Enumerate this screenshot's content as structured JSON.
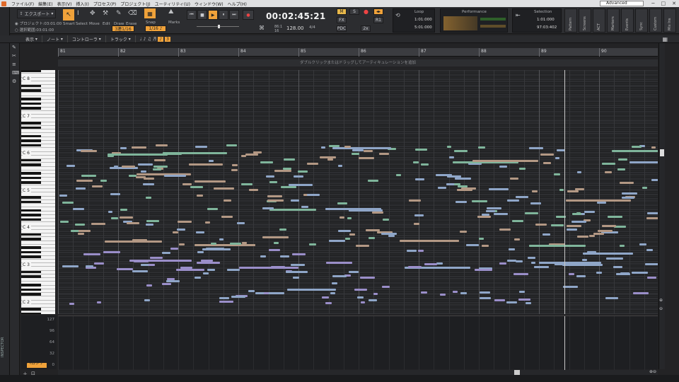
{
  "menu": [
    "ファイル(F)",
    "編集(E)",
    "表示(V)",
    "挿入(I)",
    "プロセス(P)",
    "プロジェクト(J)",
    "ユーティリティ(U)",
    "ウィンドウ(W)",
    "ヘルプ(H)"
  ],
  "workspace": "Advanced",
  "export": {
    "label": "エクスポート"
  },
  "project_info": {
    "project": "プロジェクト:03:01:00",
    "selection": "選択範囲:03:01:00"
  },
  "tools": [
    "Smart",
    "Select",
    "Move",
    "Edit",
    "Draw",
    "Erase"
  ],
  "snap": {
    "label": "Snap",
    "value": "3連1/16",
    "grid": "1/16",
    "marks": "Marks",
    "count": "3"
  },
  "transport": {
    "time": "00:02:45:21",
    "tempo": "128.00",
    "meter": "4/4",
    "measure": "86:1",
    "beat": "4/4",
    "sub": "16"
  },
  "mix": {
    "m": "M",
    "s": "S",
    "fx": "FX",
    "pdc": "PDC",
    "r1": "R1",
    "x2": "2x"
  },
  "loop": {
    "title": "Loop",
    "start": "1:01:000",
    "end": "5:01:000"
  },
  "performance": {
    "title": "Performance"
  },
  "selection": {
    "title": "Selection",
    "start": "1:01:000",
    "end": "97:03:402"
  },
  "side_tabs": [
    "Pattern",
    "Screens",
    "ACT",
    "Markers",
    "Events",
    "Sync",
    "Custom",
    "Mix Ins"
  ],
  "subtool": {
    "view": "表示",
    "note": "ノート",
    "controller": "コントローラ",
    "track": "トラック"
  },
  "hint": "ダブルクリックまたはドラッグしてアーティキュレーションを追加",
  "bars": [
    "81",
    "82",
    "83",
    "84",
    "85",
    "86",
    "87",
    "88",
    "89",
    "90"
  ],
  "octaves": [
    "C 8",
    "C 7",
    "C 6",
    "C 5",
    "C 4",
    "C 3",
    "C 2"
  ],
  "velocity_ticks": [
    "127",
    "96",
    "64",
    "32",
    "0"
  ],
  "velocity_label": "ベロシティ",
  "inspector": "INSPECTOR",
  "colors": {
    "green": "#7fb59b",
    "tan": "#b39884",
    "blue": "#8fa6c8",
    "purple": "#9a8ec9"
  }
}
